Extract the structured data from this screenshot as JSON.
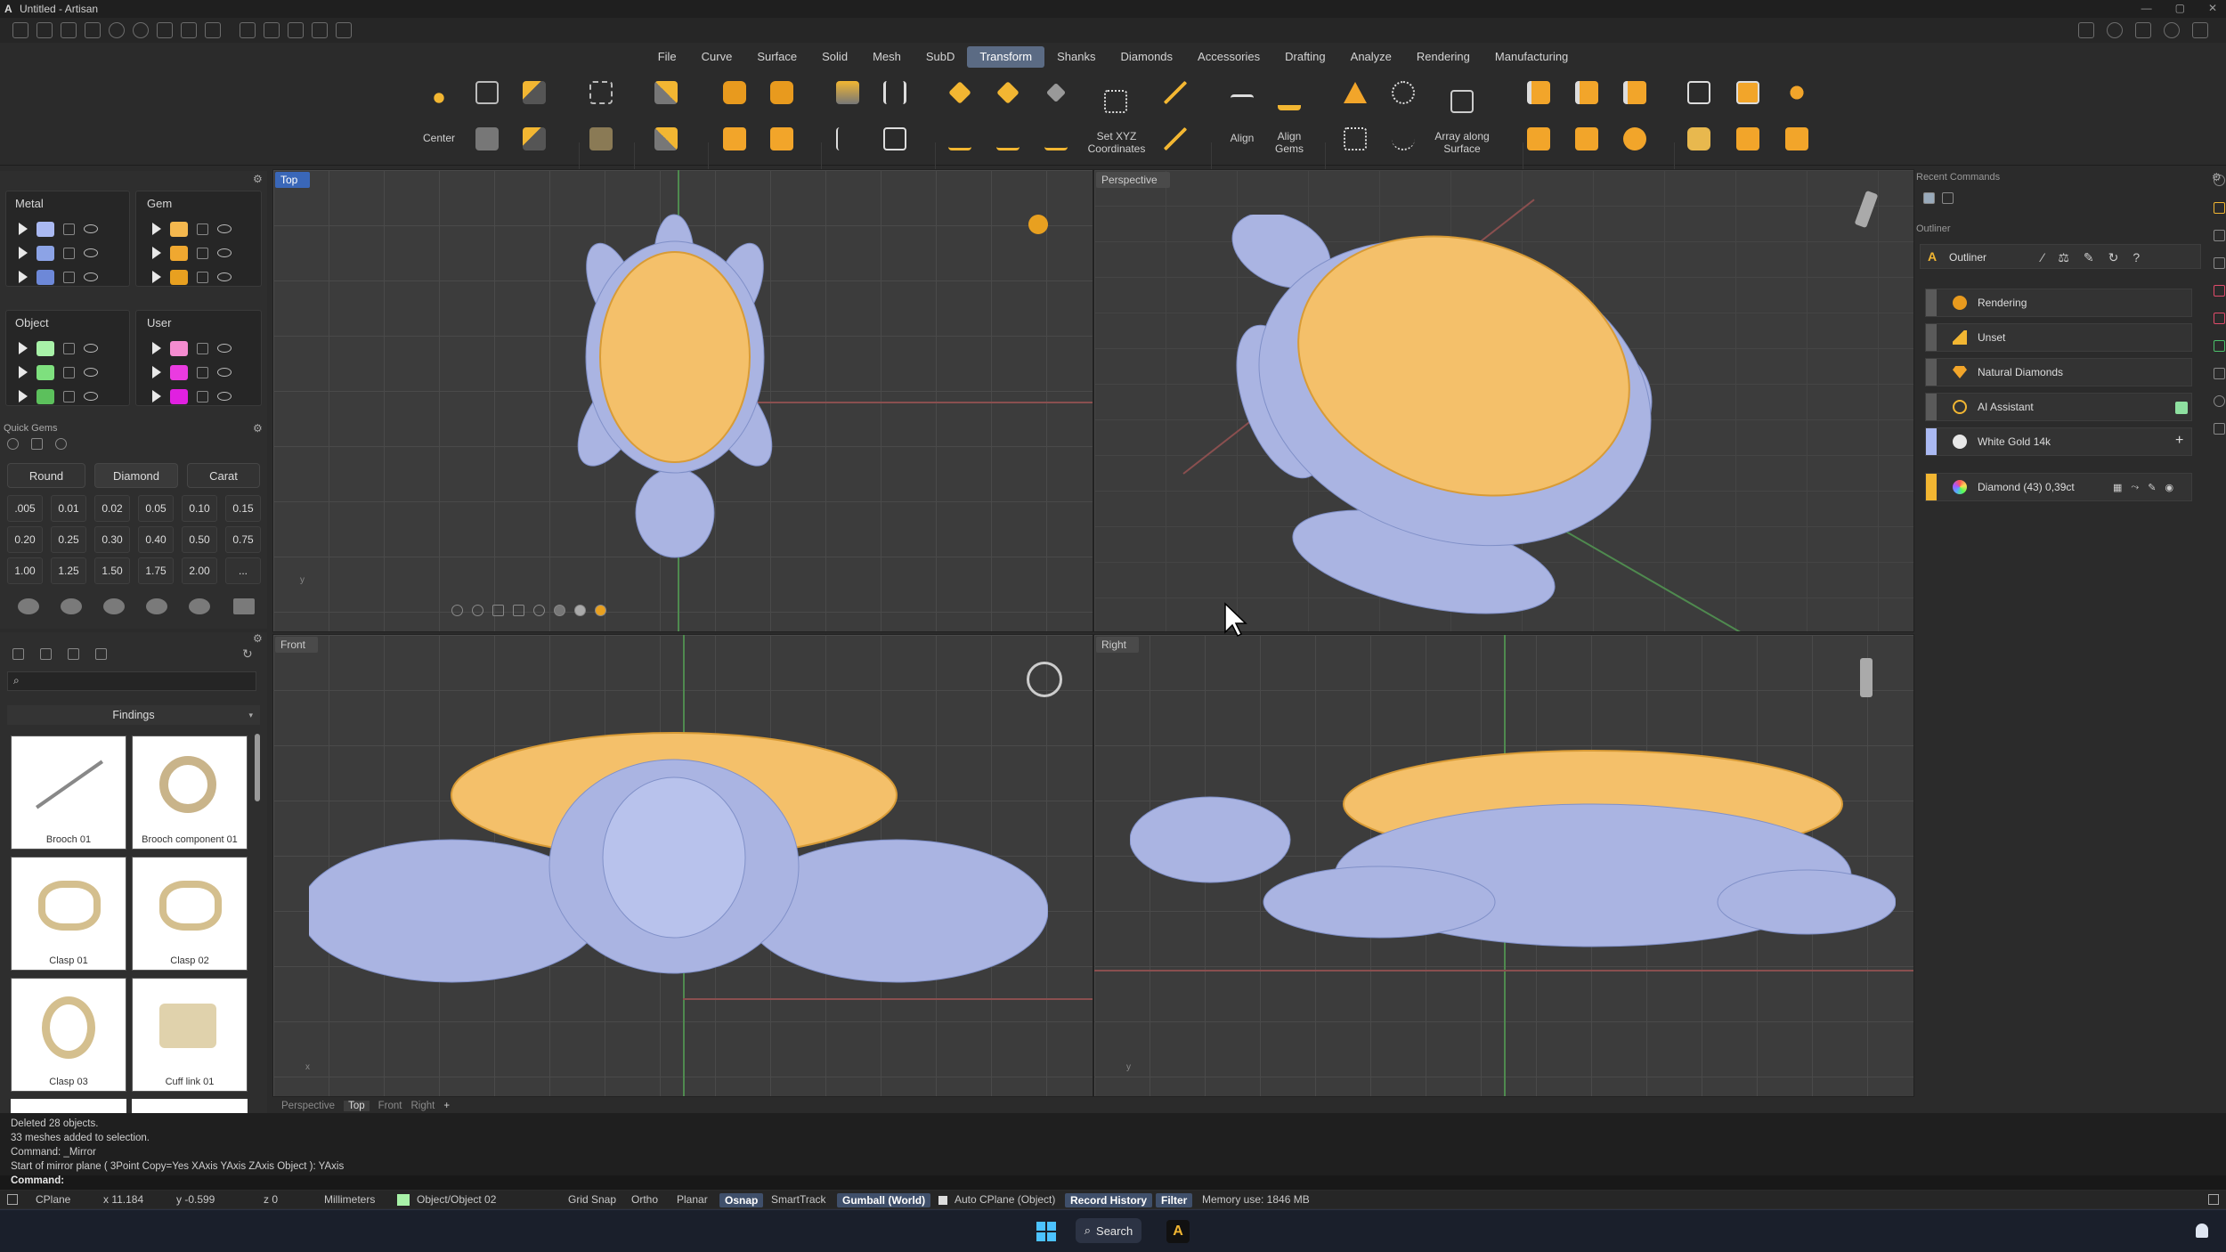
{
  "window": {
    "title": "Untitled - Artisan"
  },
  "menu": [
    "File",
    "Curve",
    "Surface",
    "Solid",
    "Mesh",
    "SubD",
    "Transform",
    "Shanks",
    "Diamonds",
    "Accessories",
    "Drafting",
    "Analyze",
    "Rendering",
    "Manufacturing"
  ],
  "active_menu": "Transform",
  "ribbon": {
    "center": "Center",
    "set_xyz": "Set XYZ\nCoordinates",
    "align": "Align",
    "align_gems": "Align\nGems",
    "array_surface": "Array along\nSurface"
  },
  "layers": {
    "metal": "Metal",
    "gem": "Gem",
    "object": "Object",
    "user": "User",
    "metal_colors": [
      "#aab9f2",
      "#8ca3e6",
      "#6d88d8"
    ],
    "gem_colors": [
      "#f5b84e",
      "#f0a830",
      "#e8a020"
    ],
    "object_colors": [
      "#a8f2a8",
      "#7ee07e",
      "#5cc05c"
    ],
    "user_colors": [
      "#f58cd0",
      "#ea3be0",
      "#e020e0"
    ]
  },
  "quick_gems": {
    "title": "Quick Gems",
    "shape": "Round",
    "cut": "Diamond",
    "mode": "Carat",
    "carats": [
      ".005",
      "0.01",
      "0.02",
      "0.05",
      "0.10",
      "0.15",
      "0.20",
      "0.25",
      "0.30",
      "0.40",
      "0.50",
      "0.75",
      "1.00",
      "1.25",
      "1.50",
      "1.75",
      "2.00",
      "..."
    ]
  },
  "library": {
    "category": "Findings",
    "items": [
      "Brooch 01",
      "Brooch component 01",
      "Clasp 01",
      "Clasp 02",
      "Clasp 03",
      "Cuff link 01"
    ]
  },
  "viewports": {
    "top": "Top",
    "perspective": "Perspective",
    "front": "Front",
    "right": "Right"
  },
  "view_tabs": [
    "Perspective",
    "Top",
    "Front",
    "Right"
  ],
  "active_view_tab": "Top",
  "right_panel": {
    "recent_commands": "Recent Commands",
    "outliner_section": "Outliner",
    "outliner_title": "Outliner",
    "items": [
      "Rendering",
      "Unset",
      "Natural Diamonds",
      "AI Assistant",
      "White Gold 14k"
    ],
    "diamond_row": "Diamond (43) 0,39ct"
  },
  "command_log": [
    "Deleted 28 objects.",
    "33 meshes added to selection.",
    "Command: _Mirror",
    "Start of mirror plane ( 3Point  Copy=Yes  XAxis  YAxis  ZAxis  Object ): YAxis"
  ],
  "command_prompt": "Command:",
  "status": {
    "cplane": "CPlane",
    "x": "x 11.184",
    "y": "y -0.599",
    "z": "z 0",
    "units": "Millimeters",
    "layer": "Object/Object 02",
    "grid_snap": "Grid Snap",
    "ortho": "Ortho",
    "planar": "Planar",
    "osnap": "Osnap",
    "smarttrack": "SmartTrack",
    "gumball": "Gumball (World)",
    "auto_cplane": "Auto CPlane (Object)",
    "record_history": "Record History",
    "filter": "Filter",
    "memory": "Memory use: 1846 MB"
  },
  "taskbar": {
    "search": "Search"
  }
}
